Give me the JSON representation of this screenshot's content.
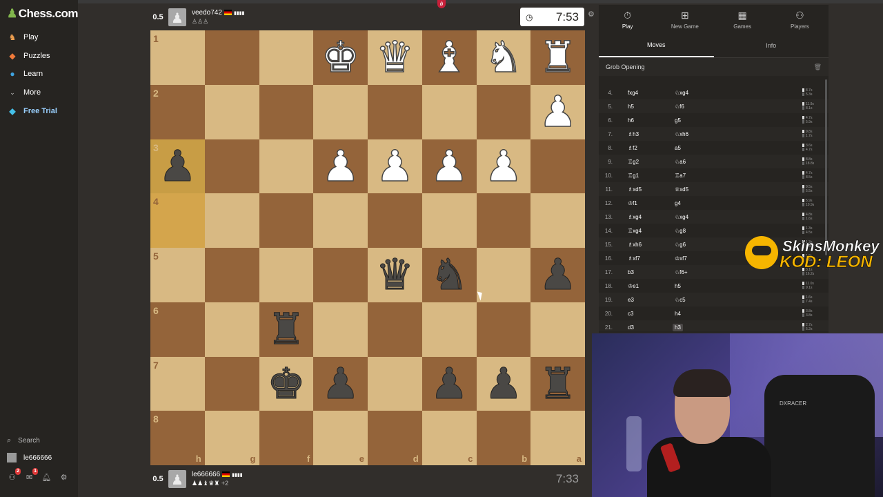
{
  "app": {
    "logo": "Chess.com",
    "nav": [
      {
        "label": "Play",
        "icon": "play-icon"
      },
      {
        "label": "Puzzles",
        "icon": "puzzle-icon"
      },
      {
        "label": "Learn",
        "icon": "learn-icon"
      },
      {
        "label": "More",
        "icon": "chevron-down-icon"
      },
      {
        "label": "Free Trial",
        "icon": "diamond-icon"
      }
    ],
    "search_label": "Search",
    "username": "le666666",
    "badges": {
      "friends": "2",
      "messages": "1"
    }
  },
  "top_player": {
    "score": "0.5",
    "name": "veedo742",
    "rating_bars": "▮▮▮▮",
    "captured": "♙♙♙",
    "clock": "7:53"
  },
  "bottom_player": {
    "score": "0.5",
    "name": "le666666",
    "rating_bars": "▮▮▮▮",
    "captured": "♟♟♝♛♜",
    "captured_extra": "+2",
    "clock": "7:33"
  },
  "board": {
    "ranks": [
      "1",
      "2",
      "3",
      "4",
      "5",
      "6",
      "7",
      "8"
    ],
    "files": [
      "h",
      "g",
      "f",
      "e",
      "d",
      "c",
      "b",
      "a"
    ],
    "rows": [
      [
        "",
        "",
        "",
        "wK",
        "wQ",
        "wB",
        "wN",
        "wR"
      ],
      [
        "",
        "",
        "",
        "",
        "",
        "",
        "",
        "wP"
      ],
      [
        "bP",
        "",
        "",
        "wP",
        "wP",
        "wP",
        "wP",
        ""
      ],
      [
        "",
        "",
        "",
        "",
        "",
        "",
        "",
        ""
      ],
      [
        "",
        "",
        "",
        "",
        "bQ",
        "bN",
        "",
        "bP"
      ],
      [
        "",
        "",
        "bR",
        "",
        "",
        "",
        "",
        ""
      ],
      [
        "",
        "",
        "bK",
        "bP",
        "",
        "bP",
        "bP",
        "bR"
      ],
      [
        "",
        "",
        "",
        "",
        "",
        "",
        "",
        ""
      ]
    ],
    "highlighted": [
      "h3",
      "h4"
    ]
  },
  "panel": {
    "top_tabs": [
      {
        "label": "Play",
        "icon": "stopwatch-icon"
      },
      {
        "label": "New Game",
        "icon": "plus-square-icon"
      },
      {
        "label": "Games",
        "icon": "board-icon"
      },
      {
        "label": "Players",
        "icon": "players-icon"
      }
    ],
    "sub_tabs": [
      "Moves",
      "Info"
    ],
    "opening": "Grob Opening",
    "moves": [
      {
        "n": "4.",
        "w": "fxg4",
        "b": "♘xg4",
        "tw": "8.7s",
        "tb": "5.3s"
      },
      {
        "n": "5.",
        "w": "h5",
        "b": "♘f6",
        "tw": "11.9s",
        "tb": "8.1s"
      },
      {
        "n": "6.",
        "w": "h6",
        "b": "g5",
        "tw": "4.7s",
        "tb": "5.9s"
      },
      {
        "n": "7.",
        "w": "♗h3",
        "b": "♘xh6",
        "tw": "9.8s",
        "tb": "1.7s"
      },
      {
        "n": "8.",
        "w": "♗f2",
        "b": "a5",
        "tw": "3.6s",
        "tb": "4.7s"
      },
      {
        "n": "9.",
        "w": "♖g2",
        "b": "♘a6",
        "tw": "8.8s",
        "tb": "18.8s"
      },
      {
        "n": "10.",
        "w": "♖g1",
        "b": "♖a7",
        "tw": "4.7s",
        "tb": "8.5s"
      },
      {
        "n": "11.",
        "w": "♗xd5",
        "b": "♕xd5",
        "tw": "9.5s",
        "tb": "5.5s"
      },
      {
        "n": "12.",
        "w": "♔f1",
        "b": "g4",
        "tw": "5.9s",
        "tb": "10.9s"
      },
      {
        "n": "13.",
        "w": "♗xg4",
        "b": "♘xg4",
        "tw": "4.8s",
        "tb": "1.6s"
      },
      {
        "n": "14.",
        "w": "♖xg4",
        "b": "♘g8",
        "tw": "1.3s",
        "tb": "4.5s"
      },
      {
        "n": "15.",
        "w": "♗xh6",
        "b": "♘g6",
        "tw": "1.3s",
        "tb": "6.4s"
      },
      {
        "n": "16.",
        "w": "♗xf7",
        "b": "♔xf7",
        "tw": "1.9s",
        "tb": "0.6s"
      },
      {
        "n": "17.",
        "w": "b3",
        "b": "♘f6+",
        "tw": "3.1s",
        "tb": "16.2s"
      },
      {
        "n": "18.",
        "w": "♔e1",
        "b": "h5",
        "tw": "11.0s",
        "tb": "9.1s"
      },
      {
        "n": "19.",
        "w": "e3",
        "b": "♘c5",
        "tw": "1.6s",
        "tb": "7.4s"
      },
      {
        "n": "20.",
        "w": "c3",
        "b": "h4",
        "tw": "3.8s",
        "tb": "3.8s"
      },
      {
        "n": "21.",
        "w": "d3",
        "b": "h3",
        "tw": "2.7s",
        "tb": "5.2s"
      }
    ]
  },
  "promo": {
    "line1": "SkinsMonkey",
    "line2": "KOD: LEON"
  },
  "webcam": {
    "chair_logo": "DXRACER"
  },
  "colors": {
    "light_square": "#d8b983",
    "dark_square": "#94643a",
    "highlight": "#c89d45",
    "accent": "#81b64c",
    "promo": "#f6b500"
  }
}
